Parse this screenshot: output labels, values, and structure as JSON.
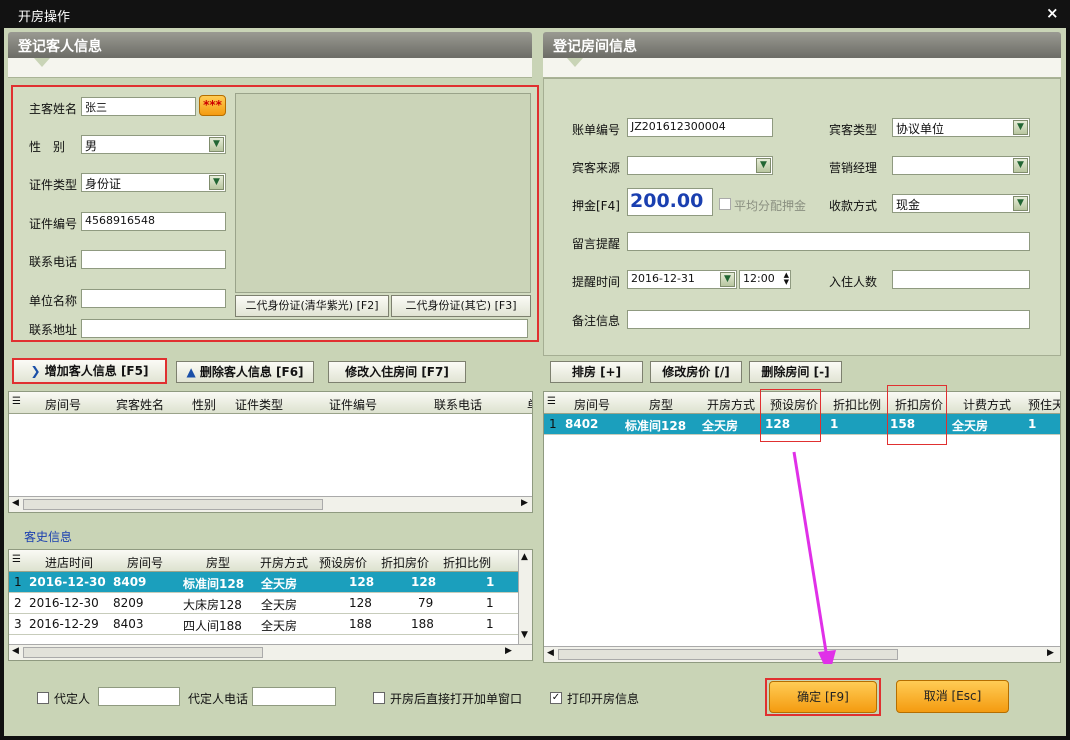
{
  "window": {
    "title": "开房操作",
    "close": "×"
  },
  "guest": {
    "header": "登记客人信息",
    "labels": {
      "name": "主客姓名",
      "gender": "性　别",
      "id_type": "证件类型",
      "id_no": "证件编号",
      "phone": "联系电话",
      "company": "单位名称",
      "address": "联系地址"
    },
    "values": {
      "name": "张三",
      "gender": "男",
      "id_type": "身份证",
      "id_no": "4568916548",
      "phone": "",
      "company": "",
      "address": ""
    },
    "more_btn": "***",
    "id_reader_1": "二代身份证(清华紫光) [F2]",
    "id_reader_2": "二代身份证(其它) [F3]"
  },
  "guest_actions": {
    "add": "增加客人信息 [F5]",
    "delete": "删除客人信息 [F6]",
    "modify_room": "修改入住房间 [F7]"
  },
  "guest_table": {
    "columns": [
      "房间号",
      "宾客姓名",
      "性别",
      "证件类型",
      "证件编号",
      "联系电话",
      "单"
    ]
  },
  "history": {
    "title": "客史信息",
    "columns": [
      "进店时间",
      "房间号",
      "房型",
      "开房方式",
      "预设房价",
      "折扣房价",
      "折扣比例"
    ],
    "rows": [
      {
        "n": "1",
        "date": "2016-12-30",
        "room": "8409",
        "type": "标准间128",
        "mode": "全天房",
        "preset": "128",
        "disc": "128",
        "ratio": "1"
      },
      {
        "n": "2",
        "date": "2016-12-30",
        "room": "8209",
        "type": "大床房128",
        "mode": "全天房",
        "preset": "128",
        "disc": "79",
        "ratio": "1"
      },
      {
        "n": "3",
        "date": "2016-12-29",
        "room": "8403",
        "type": "四人间188",
        "mode": "全天房",
        "preset": "188",
        "disc": "188",
        "ratio": "1"
      }
    ]
  },
  "room": {
    "header": "登记房间信息",
    "labels": {
      "bill_no": "账单编号",
      "guest_type": "宾客类型",
      "source": "宾客来源",
      "sales": "营销经理",
      "deposit": "押金[F4]",
      "avg_deposit": "平均分配押金",
      "pay": "收款方式",
      "message": "留言提醒",
      "remind_time": "提醒时间",
      "count": "入住人数",
      "remark": "备注信息"
    },
    "values": {
      "bill_no": "JZ201612300004",
      "guest_type": "协议单位",
      "source": "",
      "sales": "",
      "deposit": "200.00",
      "pay": "现金",
      "message": "",
      "remind_date": "2016-12-31",
      "remind_hour": "12:00",
      "count": "",
      "remark": ""
    }
  },
  "room_actions": {
    "arrange": "排房 [+]",
    "price": "修改房价 [/]",
    "delete": "删除房间 [-]"
  },
  "room_table": {
    "columns": [
      "房间号",
      "房型",
      "开房方式",
      "预设房价",
      "折扣比例",
      "折扣房价",
      "计费方式",
      "预住天"
    ],
    "rows": [
      {
        "n": "1",
        "room": "8402",
        "type": "标准间128",
        "mode": "全天房",
        "preset": "128",
        "ratio": "1",
        "disc": "158",
        "billing": "全天房",
        "days": "1"
      }
    ]
  },
  "footer": {
    "agent": "代定人",
    "agent_phone": "代定人电话",
    "open_bill": "开房后直接打开加单窗口",
    "print": "打印开房信息",
    "confirm": "确定 [F9]",
    "cancel": "取消 [Esc]"
  },
  "colors": {
    "selected_row": "#1b9fbd",
    "accent_arrow": "#e030e8",
    "highlight_box": "#e03030",
    "button_orange": "#f49b10"
  }
}
